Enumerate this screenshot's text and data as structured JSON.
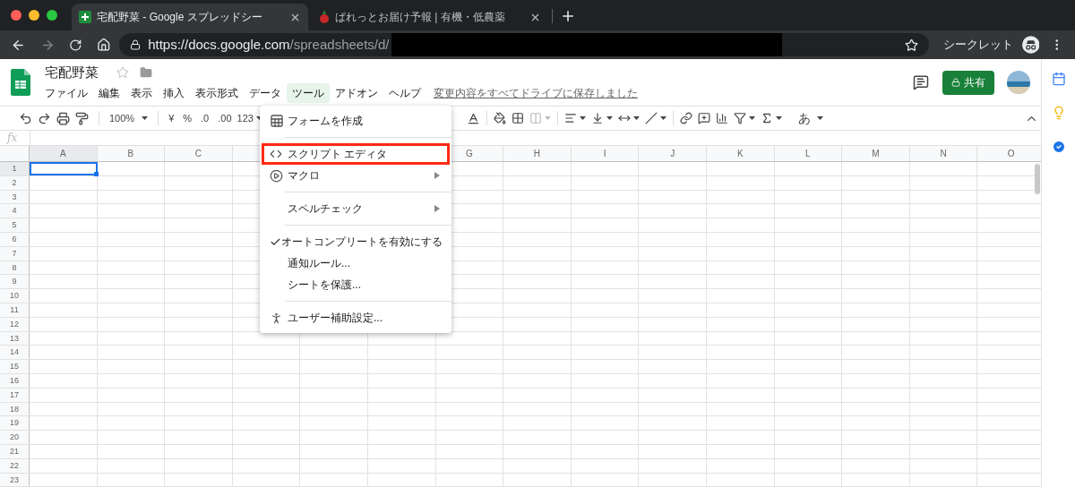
{
  "browser": {
    "tabs": [
      {
        "title": "宅配野菜 - Google スプレッドシー",
        "selected": true
      },
      {
        "title": "ぱれっとお届け予報 | 有機・低農薬",
        "selected": false
      }
    ],
    "url": {
      "host": "https://docs.google.com",
      "path": "/spreadsheets/d/"
    },
    "incognito_label": "シークレット"
  },
  "document": {
    "title": "宅配野菜",
    "share_button": "共有",
    "save_status": "変更内容をすべてドライブに保存しました"
  },
  "menu_bar": [
    {
      "label": "ファイル",
      "selected": false
    },
    {
      "label": "編集",
      "selected": false
    },
    {
      "label": "表示",
      "selected": false
    },
    {
      "label": "挿入",
      "selected": false
    },
    {
      "label": "表示形式",
      "selected": false
    },
    {
      "label": "データ",
      "selected": false
    },
    {
      "label": "ツール",
      "selected": true
    },
    {
      "label": "アドオン",
      "selected": false
    },
    {
      "label": "ヘルプ",
      "selected": false
    }
  ],
  "toolbar": {
    "zoom": "100%",
    "currency": "¥",
    "percent": "%",
    "decrease_decimals": ".0",
    "increase_decimals": ".00",
    "more_formats": "123",
    "input_tools": "あ"
  },
  "formula_bar": {
    "label": "fx"
  },
  "tools_menu": [
    {
      "label": "フォームを作成",
      "kind": "form",
      "checked": false,
      "submenu": false,
      "highlighted": false
    },
    {
      "kind": "separator"
    },
    {
      "label": "スクリプト エディタ",
      "kind": "script",
      "checked": false,
      "submenu": false,
      "highlighted": true
    },
    {
      "label": "マクロ",
      "kind": "macro",
      "checked": false,
      "submenu": true,
      "highlighted": false
    },
    {
      "kind": "separator"
    },
    {
      "label": "スペルチェック",
      "kind": "plain",
      "checked": false,
      "submenu": true,
      "highlighted": false
    },
    {
      "kind": "separator"
    },
    {
      "label": "オートコンプリートを有効にする",
      "kind": "plain",
      "checked": true,
      "submenu": false,
      "highlighted": false
    },
    {
      "label": "通知ルール...",
      "kind": "plain",
      "checked": false,
      "submenu": false,
      "highlighted": false
    },
    {
      "label": "シートを保護...",
      "kind": "plain",
      "checked": false,
      "submenu": false,
      "highlighted": false
    },
    {
      "kind": "separator"
    },
    {
      "label": "ユーザー補助設定...",
      "kind": "accessibility",
      "checked": false,
      "submenu": false,
      "highlighted": false
    }
  ],
  "grid": {
    "columns_left": [
      "A",
      "B",
      "C"
    ],
    "columns_right": [
      "G",
      "H",
      "I",
      "J",
      "K",
      "L",
      "M",
      "N",
      "O"
    ],
    "rows": [
      "1",
      "2",
      "3",
      "4",
      "5",
      "6",
      "7",
      "8",
      "9",
      "10",
      "11",
      "12",
      "13",
      "14",
      "15",
      "16",
      "17",
      "18",
      "19",
      "20",
      "21",
      "22",
      "23"
    ]
  }
}
